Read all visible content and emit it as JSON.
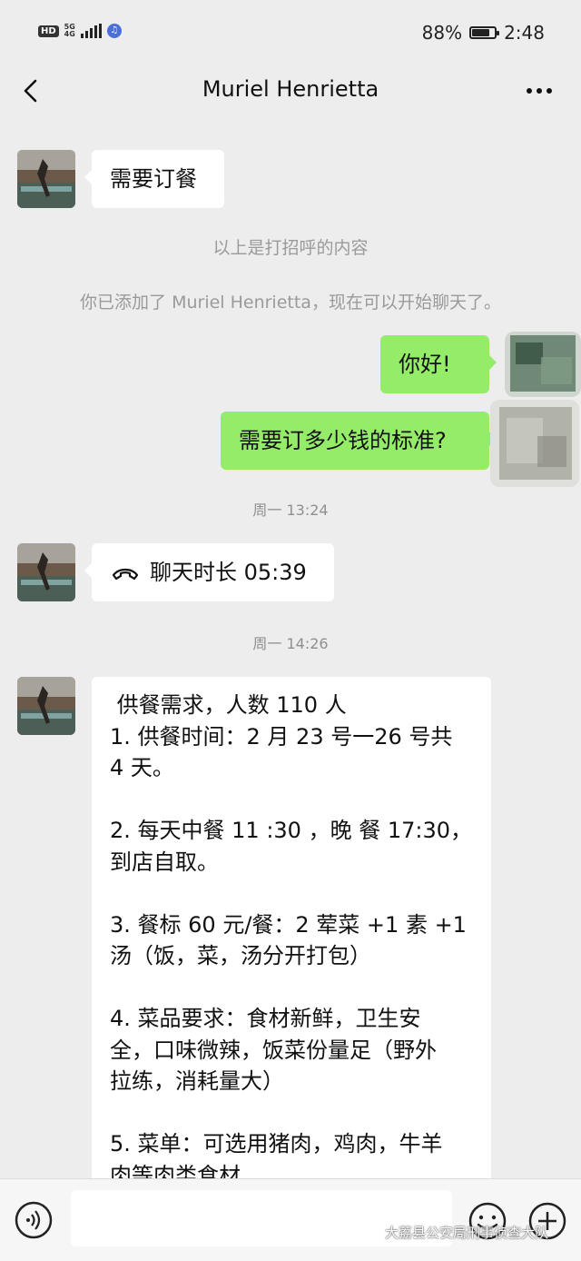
{
  "status_bar": {
    "hd": "HD",
    "network_top": "5G",
    "network_bottom": "4G",
    "battery_text": "88%",
    "battery_level": 0.88,
    "time": "2:48"
  },
  "header": {
    "title": "Muriel Henrietta"
  },
  "messages": {
    "greeting_in": "需要订餐",
    "sys_greeting_note": "以上是打招呼的内容",
    "sys_added_note": "你已添加了 Muriel Henrietta，现在可以开始聊天了。",
    "out_hello": "你好!",
    "out_budget": "需要订多少钱的标准?",
    "timestamp_1": "周一 13:24",
    "call_text": "聊天时长 05:39",
    "timestamp_2": "周一 14:26",
    "order_lines": [
      " 供餐需求，人数 110 人",
      "1. 供餐时间：2 月 23 号一26 号共",
      "4 天。",
      "",
      "2. 每天中餐 11 :30 ，晚 餐 17:30，",
      "到店自取。",
      "",
      "3. 餐标 60 元/餐：2 荤菜 +1 素 +1",
      "汤（饭，菜，汤分开打包）",
      "",
      "4. 菜品要求：食材新鲜，卫生安",
      "全，口味微辣，饭菜份量足（野外",
      "拉练，消耗量大）",
      "",
      "5. 菜单：可选用猪肉，鸡肉，牛羊",
      "肉等肉类食材"
    ]
  },
  "input_bar": {
    "placeholder": "",
    "watermark": "大荔县公安局刑事侦查大队"
  },
  "colors": {
    "background": "#ededed",
    "bubble_in": "#ffffff",
    "bubble_out": "#95ec69",
    "system_text": "#9a9a9a"
  },
  "icons": [
    "back-arrow-icon",
    "more-dots-icon",
    "phone-call-icon",
    "voice-icon",
    "emoji-icon",
    "plus-icon",
    "wechat-logo-icon"
  ]
}
